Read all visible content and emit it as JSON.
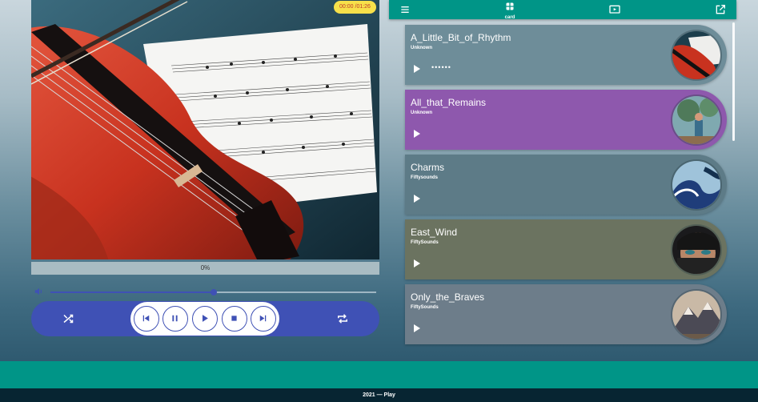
{
  "player": {
    "time": "00:00 /01:26",
    "progress_label": "0%",
    "progress_fraction": 0,
    "volume_fraction": 0.5,
    "artwork_icon": "violin-sheet-music-artwork",
    "accent_color": "#3f51b5",
    "controls": [
      "shuffle-icon",
      "skip-previous-icon",
      "pause-icon",
      "play-icon",
      "stop-icon",
      "skip-next-icon",
      "repeat-icon"
    ]
  },
  "topbar": {
    "card_label": "card",
    "icons": [
      "menu-icon",
      "card-view-icon",
      "video-icon",
      "open-external-icon"
    ],
    "color": "#009587"
  },
  "tracks": [
    {
      "title": "A_Little_Bit_of_Rhythm",
      "artist": "Unknown",
      "status": "••••••",
      "bg": "#6e8d99",
      "thumb_icon": "violin-thumbnail"
    },
    {
      "title": "All_that_Remains",
      "artist": "Unknown",
      "status": "",
      "bg": "#8e58ad",
      "thumb_icon": "girl-tree-thumbnail"
    },
    {
      "title": "Charms",
      "artist": "Fiftysounds",
      "status": "",
      "bg": "#5d7b87",
      "thumb_icon": "wave-thumbnail"
    },
    {
      "title": "East_Wind",
      "artist": "FiftySounds",
      "status": "",
      "bg": "#6b7360",
      "thumb_icon": "face-eyes-thumbnail"
    },
    {
      "title": "Only_the_Braves",
      "artist": "FiftySounds",
      "status": "",
      "bg": "#6d7d8a",
      "thumb_icon": "mountain-thumbnail"
    }
  ],
  "footer": {
    "text": "2021 — Play",
    "band_color": "#009587",
    "bar_color": "#072532"
  }
}
